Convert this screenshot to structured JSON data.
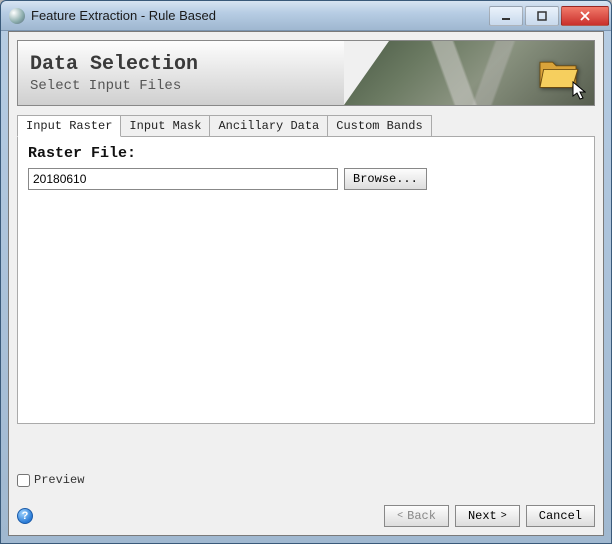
{
  "window": {
    "title": "Feature Extraction - Rule Based"
  },
  "banner": {
    "title": "Data Selection",
    "subtitle": "Select Input Files"
  },
  "tabs": [
    {
      "label": "Input Raster",
      "active": true
    },
    {
      "label": "Input Mask",
      "active": false
    },
    {
      "label": "Ancillary Data",
      "active": false
    },
    {
      "label": "Custom Bands",
      "active": false
    }
  ],
  "panel": {
    "label": "Raster File:",
    "value": "20180610",
    "browse_label": "Browse..."
  },
  "footer": {
    "preview_label": "Preview",
    "preview_checked": false,
    "back_label": "Back",
    "next_label": "Next",
    "cancel_label": "Cancel"
  },
  "icons": {
    "app": "envi-globe-icon",
    "banner": "folder-open-icon",
    "cursor": "cursor-arrow-icon",
    "help": "help-icon"
  }
}
